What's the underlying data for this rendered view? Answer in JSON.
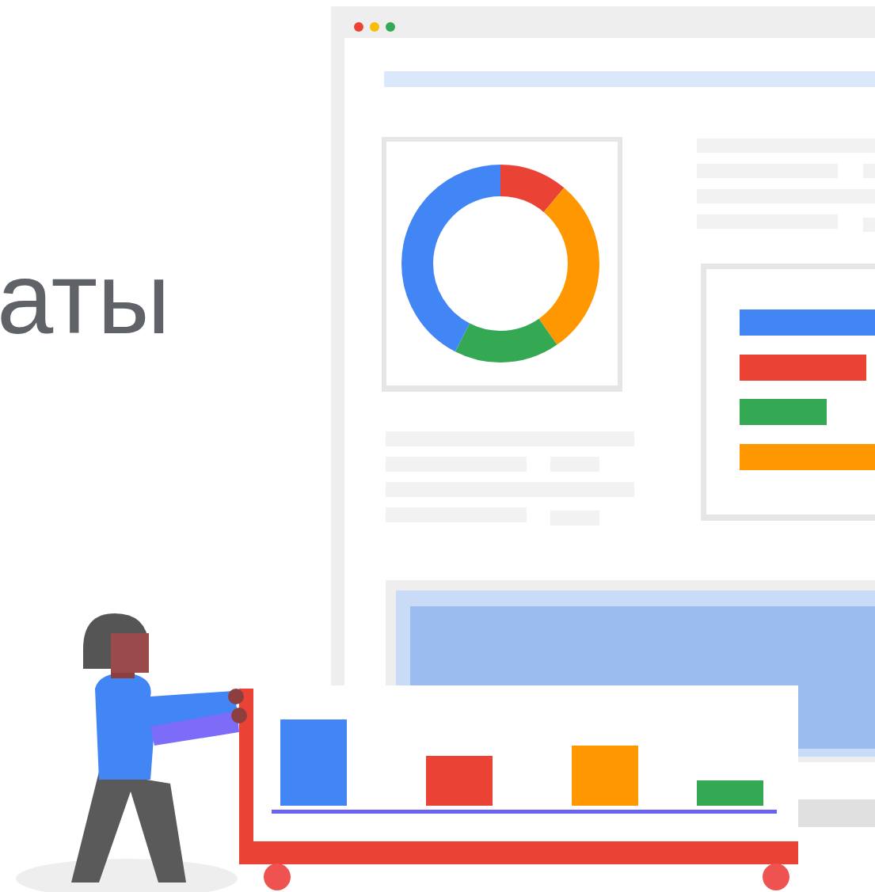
{
  "heading": "аты"
}
